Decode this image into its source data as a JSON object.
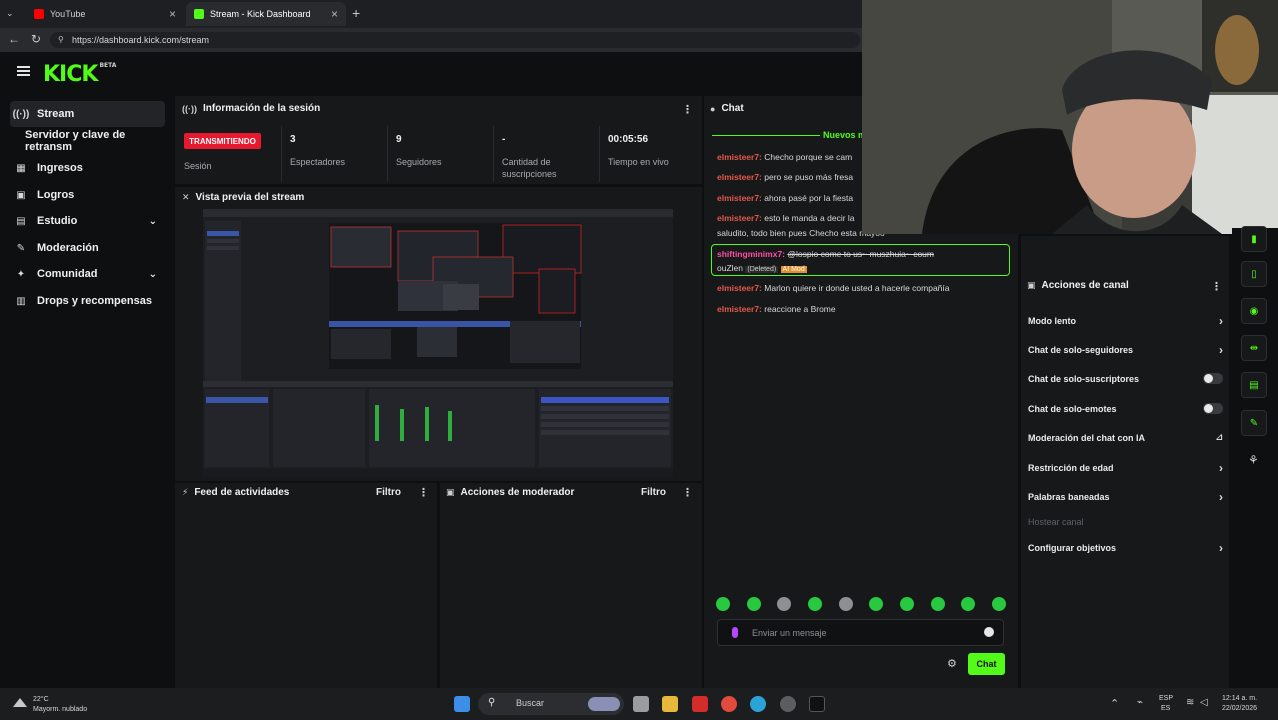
{
  "browser": {
    "tabs": [
      {
        "label": "YouTube"
      },
      {
        "label": "Stream - Kick Dashboard"
      }
    ],
    "url": "https://dashboard.kick.com/stream"
  },
  "app": {
    "logo": "KICK",
    "logo_sup": "BETA"
  },
  "sidebar": {
    "items": [
      {
        "label": "Stream"
      },
      {
        "label": "Servidor y clave de retransm"
      },
      {
        "label": "Ingresos"
      },
      {
        "label": "Logros"
      },
      {
        "label": "Estudio"
      },
      {
        "label": "Moderación"
      },
      {
        "label": "Comunidad"
      },
      {
        "label": "Drops y recompensas"
      }
    ]
  },
  "session": {
    "title": "Información de la sesión",
    "status_badge": "TRANSMITIENDO",
    "status_label": "Sesión",
    "stats": [
      {
        "value": "3",
        "label": "Espectadores"
      },
      {
        "value": "9",
        "label": "Seguidores"
      },
      {
        "value": "-",
        "label": "Cantidad de suscripciones"
      },
      {
        "value": "00:05:56",
        "label": "Tiempo en vivo"
      }
    ]
  },
  "preview": {
    "title": "Vista previa del stream"
  },
  "activity": {
    "title": "Feed de actividades",
    "filter": "Filtro"
  },
  "modactions": {
    "title": "Acciones de moderador",
    "filter": "Filtro"
  },
  "chat": {
    "title": "Chat",
    "new_messages": "Nuevos m",
    "messages": [
      {
        "user": "elmisteer7:",
        "text": "Checho porque se cam"
      },
      {
        "user": "elmisteer7:",
        "text": "pero se puso más fresa"
      },
      {
        "user": "elmisteer7:",
        "text": "ahora pasé por la fiesta"
      },
      {
        "user": "elmisteer7:",
        "text": "esto le manda a decir la"
      },
      {
        "user": "",
        "text": "saludito, todo bien pues Checho esta mayoo"
      },
      {
        "user": "shiftingminimx7:",
        "text": "@lospio come to us~ muszhuia~ coum"
      },
      {
        "user": "",
        "text": "ouZlen"
      },
      {
        "user": "elmisteer7:",
        "text": "Marlon quiere ir donde usted a hacerle compañía"
      },
      {
        "user": "elmisteer7:",
        "text": "reaccione a Brome"
      }
    ],
    "tag_deleted": "(Deleted)",
    "tag_mod": "AI Mod",
    "input_placeholder": "Enviar un mensaje",
    "send_label": "Chat"
  },
  "channel_actions": {
    "title": "Acciones de canal",
    "items": [
      {
        "label": "Modo lento"
      },
      {
        "label": "Chat de solo-seguidores"
      },
      {
        "label": "Chat de solo-suscriptores"
      },
      {
        "label": "Chat de solo-emotes"
      },
      {
        "label": "Moderación del chat con IA"
      },
      {
        "label": "Restricción de edad"
      },
      {
        "label": "Palabras baneadas"
      },
      {
        "label": "Hostear canal"
      },
      {
        "label": "Configurar objetivos"
      }
    ]
  },
  "taskbar": {
    "weather_temp": "22°C",
    "weather_desc": "Mayorm. nublado",
    "search": "Buscar",
    "lang_top": "ESP",
    "lang_bottom": "ES",
    "time": "12:14 a. m.",
    "date": "22/02/2026"
  },
  "colors": {
    "accent": "#53fc18",
    "live": "#e5192f",
    "username": "#e2594a"
  }
}
